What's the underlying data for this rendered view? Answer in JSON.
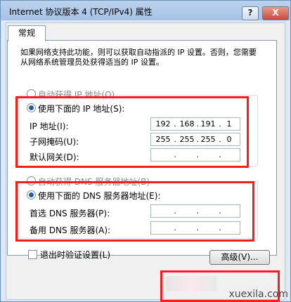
{
  "window": {
    "title": "Internet 协议版本 4 (TCP/IPv4) 属性",
    "help_label": "?",
    "close_label": "X"
  },
  "tabs": [
    {
      "label": "常规"
    }
  ],
  "description": "如果网络支持此功能，则可以获取自动指派的 IP 设置。否则，您需要从网络系统管理员处获得适当的 IP 设置。",
  "ip_section": {
    "auto_label": "自动获得 IP 地址(O)",
    "manual_label": "使用下面的 IP 地址(S):",
    "fields": [
      {
        "label": "IP 地址(I):",
        "octets": [
          "192",
          "168",
          "191",
          "1"
        ]
      },
      {
        "label": "子网掩码(U):",
        "octets": [
          "255",
          "255",
          "255",
          "0"
        ]
      },
      {
        "label": "默认网关(D):",
        "octets": [
          "",
          "",
          "",
          ""
        ]
      }
    ]
  },
  "dns_section": {
    "auto_label": "自动获得 DNS 服务器地址(B)",
    "manual_label": "使用下面的 DNS 服务器地址(E):",
    "fields": [
      {
        "label": "首选 DNS 服务器(P):",
        "octets": [
          "",
          "",
          "",
          ""
        ]
      },
      {
        "label": "备用 DNS 服务器(A):",
        "octets": [
          "",
          "",
          "",
          ""
        ]
      }
    ]
  },
  "validate_label": "退出时验证设置(L)",
  "advanced_label": "高级(V)...",
  "watermark": "xuexila.com",
  "colors": {
    "highlight": "#ff1b1b",
    "radio_dot": "#1f5da8"
  }
}
